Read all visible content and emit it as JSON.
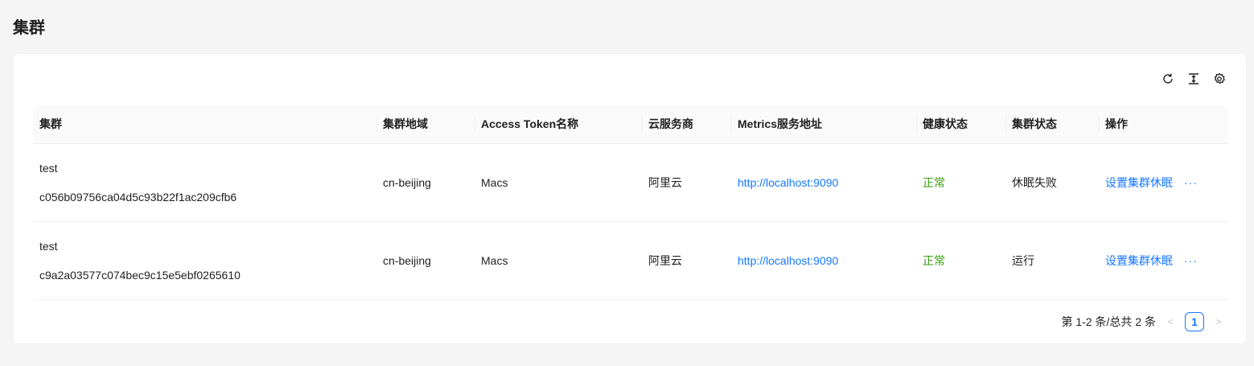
{
  "page": {
    "title": "集群"
  },
  "toolbar": {
    "icons": [
      "reload-icon",
      "column-height-icon",
      "setting-icon"
    ]
  },
  "table": {
    "columns": [
      "集群",
      "集群地域",
      "Access Token名称",
      "云服务商",
      "Metrics服务地址",
      "健康状态",
      "集群状态",
      "操作"
    ],
    "rows": [
      {
        "name": "test",
        "id": "c056b09756ca04d5c93b22f1ac209cfb6",
        "region": "cn-beijing",
        "token": "Macs",
        "provider": "阿里云",
        "metrics": "http://localhost:9090",
        "health": "正常",
        "status": "休眠失败",
        "action": "设置集群休眠",
        "more": "···"
      },
      {
        "name": "test",
        "id": "c9a2a03577c074bec9c15e5ebf0265610",
        "region": "cn-beijing",
        "token": "Macs",
        "provider": "阿里云",
        "metrics": "http://localhost:9090",
        "health": "正常",
        "status": "运行",
        "action": "设置集群休眠",
        "more": "···"
      }
    ]
  },
  "pagination": {
    "summary": "第 1-2 条/总共 2 条",
    "current": "1",
    "prev": "<",
    "next": ">"
  },
  "colors": {
    "primary": "#1677ff",
    "success": "#389e0d",
    "background": "#f5f5f5"
  }
}
